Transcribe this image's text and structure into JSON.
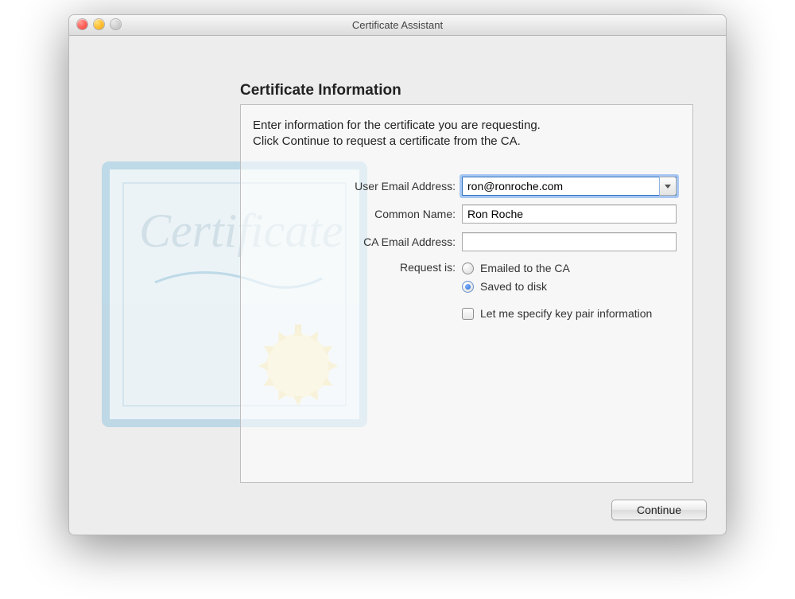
{
  "window": {
    "title": "Certificate Assistant"
  },
  "heading": "Certificate Information",
  "instructions_line1": "Enter information for the certificate you are requesting.",
  "instructions_line2": "Click Continue to request a certificate from the CA.",
  "labels": {
    "user_email": "User Email Address:",
    "common_name": "Common Name:",
    "ca_email": "CA Email Address:",
    "request_is": "Request is:"
  },
  "values": {
    "user_email": "ron@ronroche.com",
    "common_name": "Ron Roche",
    "ca_email": ""
  },
  "request_options": {
    "emailed": "Emailed to the CA",
    "saved": "Saved to disk",
    "selected": "saved"
  },
  "checkbox": {
    "specify_keypair": "Let me specify key pair information",
    "checked": false
  },
  "buttons": {
    "continue": "Continue"
  }
}
